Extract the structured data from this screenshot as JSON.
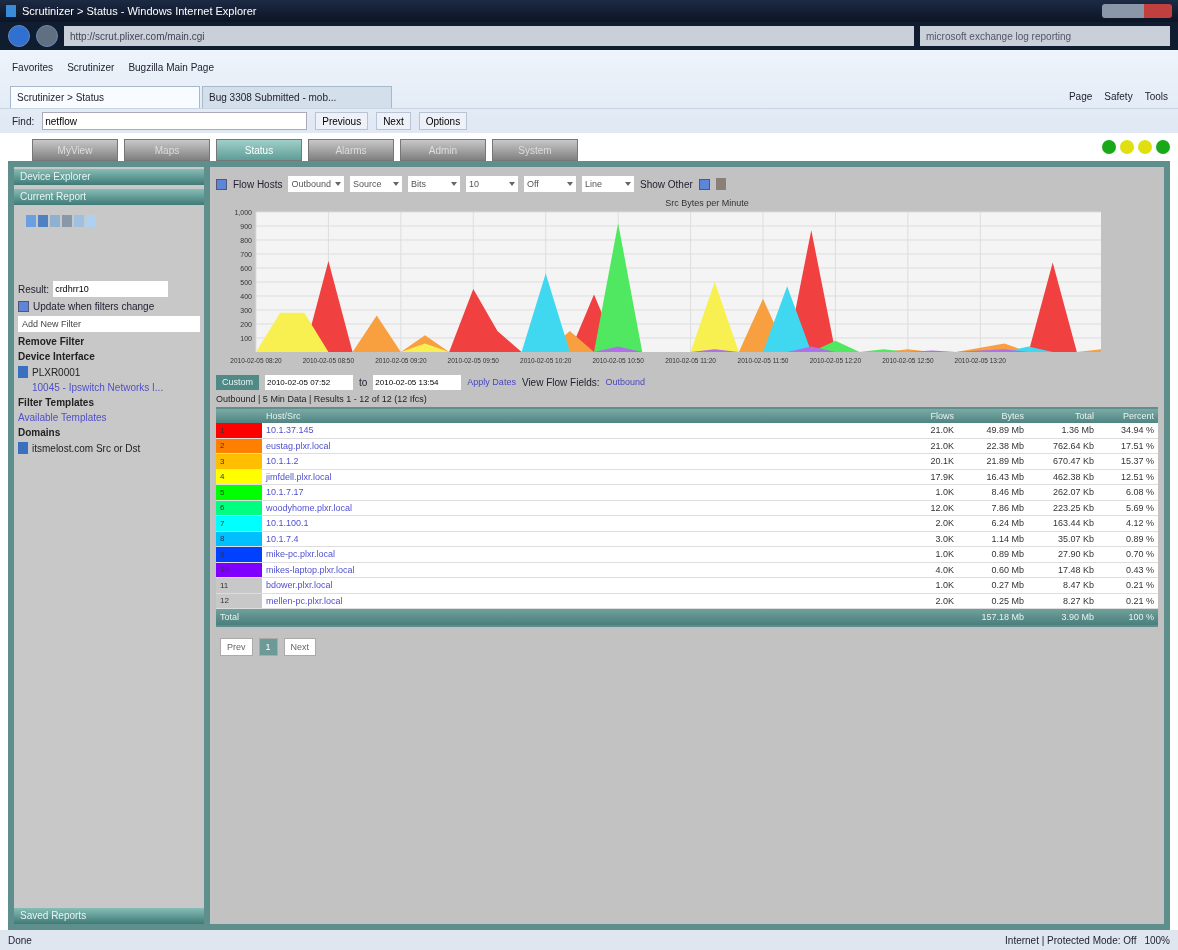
{
  "window": {
    "title": "Scrutinizer > Status - Windows Internet Explorer"
  },
  "address_bar": {
    "url": "http://scrut.plixer.com/main.cgi",
    "search_placeholder": "microsoft exchange log reporting"
  },
  "favorites_bar": {
    "items": [
      "Favorites",
      "Scrutinizer",
      "Bugzilla Main Page"
    ]
  },
  "browser_tabs": [
    {
      "label": "Scrutinizer > Status",
      "selected": true
    },
    {
      "label": "Bug 3308 Submitted - mob...",
      "selected": false
    }
  ],
  "command_bar": [
    "Page",
    "Safety",
    "Tools"
  ],
  "find_bar": {
    "label": "Find:",
    "value": "netflow",
    "buttons": [
      "Previous",
      "Next",
      "Options"
    ]
  },
  "app_tabs": [
    {
      "label": "MyView",
      "selected": false
    },
    {
      "label": "Maps",
      "selected": false
    },
    {
      "label": "Status",
      "selected": true
    },
    {
      "label": "Alarms",
      "selected": false
    },
    {
      "label": "Admin",
      "selected": false
    },
    {
      "label": "System",
      "selected": false
    }
  ],
  "status_lights": [
    {
      "color": "#18a818"
    },
    {
      "color": "#e0e010"
    },
    {
      "color": "#e0e010"
    },
    {
      "color": "#18a818"
    }
  ],
  "sidebar": {
    "headers": [
      "Device Explorer",
      "Current Report"
    ],
    "result_label": "Result:",
    "result_value": "crdhrr10",
    "update_label": "Update when filters change",
    "update_checked": true,
    "add_filter": "Add New Filter",
    "sections": [
      {
        "title": "Remove Filter"
      },
      {
        "title": "Device Interface",
        "items": [
          {
            "text": "PLXR0001",
            "kind": "device"
          },
          {
            "text": "10045 - Ipswitch Networks I...",
            "kind": "link"
          }
        ]
      },
      {
        "title": "Filter Templates",
        "items": [
          {
            "text": "Available Templates",
            "kind": "link"
          }
        ]
      },
      {
        "title": "Domains",
        "items": [
          {
            "text": "itsmelost.com Src or Dst",
            "kind": "device"
          }
        ]
      }
    ],
    "footer": "Saved Reports"
  },
  "report_toolbar": {
    "flow_hosts_label": "Flow Hosts",
    "flow_hosts_checked": true,
    "selects": [
      "Outbound",
      "Source",
      "Bits",
      "10",
      "Off",
      "Line"
    ],
    "show_other_label": "Show Other",
    "show_other_checked": true
  },
  "chart": {
    "chart_data": {
      "type": "area",
      "stacked": false,
      "grid": true,
      "title": "Src Bytes per Minute",
      "categories": [
        "2010-02-05 08:20",
        null,
        null,
        "2010-02-05 08:50",
        null,
        null,
        "2010-02-05 09:20",
        null,
        null,
        "2010-02-05 09:50",
        null,
        null,
        "2010-02-05 10:20",
        null,
        null,
        "2010-02-05 10:50",
        null,
        null,
        "2010-02-05 11:20",
        null,
        null,
        "2010-02-05 11:50",
        null,
        null,
        "2010-02-05 12:20",
        null,
        null,
        "2010-02-05 12:50",
        null,
        null,
        "2010-02-05 13:20",
        null,
        null,
        null,
        null,
        null
      ],
      "ylim": [
        0,
        1000
      ],
      "yticks": [
        {
          "value": 100,
          "label": "100"
        },
        {
          "value": 200,
          "label": "200"
        },
        {
          "value": 300,
          "label": "300"
        },
        {
          "value": 400,
          "label": "400"
        },
        {
          "value": 500,
          "label": "500"
        },
        {
          "value": 600,
          "label": "600"
        },
        {
          "value": 700,
          "label": "700"
        },
        {
          "value": 800,
          "label": "800"
        },
        {
          "value": 900,
          "label": "900"
        },
        {
          "value": 1000,
          "label": "1,000"
        }
      ],
      "series": [
        {
          "color": "#f04040",
          "values": [
            0,
            0,
            0,
            650,
            0,
            0,
            0,
            0,
            0,
            450,
            150,
            0,
            0,
            0,
            410,
            0,
            0,
            0,
            0,
            0,
            0,
            0,
            0,
            870,
            0,
            0,
            0,
            0,
            0,
            0,
            0,
            0,
            0,
            640,
            0,
            0
          ]
        },
        {
          "color": "#f8a040",
          "values": [
            0,
            0,
            0,
            0,
            0,
            260,
            0,
            120,
            0,
            0,
            0,
            0,
            0,
            150,
            0,
            0,
            0,
            0,
            0,
            0,
            0,
            380,
            0,
            0,
            0,
            0,
            0,
            20,
            0,
            0,
            30,
            60,
            0,
            0,
            0,
            20
          ]
        },
        {
          "color": "#f8f050",
          "values": [
            0,
            280,
            280,
            0,
            0,
            0,
            0,
            60,
            0,
            0,
            0,
            0,
            0,
            0,
            0,
            0,
            0,
            0,
            0,
            500,
            0,
            0,
            0,
            0,
            0,
            0,
            0,
            0,
            0,
            0,
            0,
            0,
            0,
            0,
            0,
            0
          ]
        },
        {
          "color": "#50e860",
          "values": [
            0,
            0,
            0,
            0,
            0,
            0,
            0,
            0,
            0,
            0,
            0,
            0,
            0,
            0,
            0,
            920,
            0,
            0,
            0,
            0,
            0,
            0,
            0,
            0,
            80,
            0,
            20,
            0,
            0,
            0,
            0,
            0,
            0,
            0,
            0,
            0
          ]
        },
        {
          "color": "#40d8f0",
          "values": [
            0,
            0,
            0,
            0,
            0,
            0,
            0,
            0,
            0,
            0,
            0,
            0,
            560,
            0,
            0,
            0,
            0,
            0,
            0,
            0,
            0,
            0,
            470,
            0,
            0,
            0,
            0,
            0,
            0,
            0,
            0,
            0,
            40,
            0,
            0,
            0
          ]
        },
        {
          "color": "#b070e8",
          "values": [
            0,
            0,
            0,
            0,
            0,
            0,
            0,
            0,
            0,
            0,
            0,
            0,
            0,
            0,
            0,
            40,
            0,
            0,
            0,
            20,
            0,
            0,
            0,
            40,
            0,
            0,
            0,
            0,
            10,
            0,
            10,
            20,
            0,
            0,
            0,
            0
          ]
        }
      ]
    }
  },
  "date_range": {
    "custom": "Custom",
    "from": "2010-02-05 07:52",
    "to_label": "to",
    "to": "2010-02-05 13:54",
    "apply": "Apply Dates",
    "view_label": "View Flow Fields:",
    "view_value": "Outbound"
  },
  "summary": "Outbound | 5 Min Data | Results 1 - 12 of 12 (12 Ifcs)",
  "table": {
    "columns": [
      "Host/Src",
      "Flows",
      "Bytes",
      "Total",
      "Percent"
    ],
    "rows": [
      {
        "rank": "1",
        "color": "#ff0000",
        "host": "10.1.37.145",
        "flows": "21.0K",
        "bytes": "49.89 Mb",
        "total": "1.36 Mb",
        "percent": "34.94 %"
      },
      {
        "rank": "2",
        "color": "#ff8000",
        "host": "eustag.plxr.local",
        "flows": "21.0K",
        "bytes": "22.38 Mb",
        "total": "762.64 Kb",
        "percent": "17.51 %"
      },
      {
        "rank": "3",
        "color": "#ffbf00",
        "host": "10.1.1.2",
        "flows": "20.1K",
        "bytes": "21.89 Mb",
        "total": "670.47 Kb",
        "percent": "15.37 %"
      },
      {
        "rank": "4",
        "color": "#ffff00",
        "host": "jimfdell.plxr.local",
        "flows": "17.9K",
        "bytes": "16.43 Mb",
        "total": "462.38 Kb",
        "percent": "12.51 %"
      },
      {
        "rank": "5",
        "color": "#00ff00",
        "host": "10.1.7.17",
        "flows": "1.0K",
        "bytes": "8.46 Mb",
        "total": "262.07 Kb",
        "percent": "6.08 %"
      },
      {
        "rank": "6",
        "color": "#00ff80",
        "host": "woodyhome.plxr.local",
        "flows": "12.0K",
        "bytes": "7.86 Mb",
        "total": "223.25 Kb",
        "percent": "5.69 %"
      },
      {
        "rank": "7",
        "color": "#00ffff",
        "host": "10.1.100.1",
        "flows": "2.0K",
        "bytes": "6.24 Mb",
        "total": "163.44 Kb",
        "percent": "4.12 %"
      },
      {
        "rank": "8",
        "color": "#00bfff",
        "host": "10.1.7.4",
        "flows": "3.0K",
        "bytes": "1.14 Mb",
        "total": "35.07 Kb",
        "percent": "0.89 %"
      },
      {
        "rank": "9",
        "color": "#0040ff",
        "host": "mike-pc.plxr.local",
        "flows": "1.0K",
        "bytes": "0.89 Mb",
        "total": "27.90 Kb",
        "percent": "0.70 %"
      },
      {
        "rank": "10",
        "color": "#8000ff",
        "host": "mikes-laptop.plxr.local",
        "flows": "4.0K",
        "bytes": "0.60 Mb",
        "total": "17.48 Kb",
        "percent": "0.43 %"
      },
      {
        "rank": "11",
        "color": "#c8c8c8",
        "host": "bdower.plxr.local",
        "flows": "1.0K",
        "bytes": "0.27 Mb",
        "total": "8.47 Kb",
        "percent": "0.21 %"
      },
      {
        "rank": "12",
        "color": "#c8c8c8",
        "host": "mellen-pc.plxr.local",
        "flows": "2.0K",
        "bytes": "0.25 Mb",
        "total": "8.27 Kb",
        "percent": "0.21 %"
      }
    ],
    "footer": {
      "label": "Total",
      "bytes": "157.18 Mb",
      "total": "3.90 Mb",
      "percent": "100 %"
    }
  },
  "pagination": [
    {
      "label": "Prev",
      "selected": false
    },
    {
      "label": "1",
      "selected": true
    },
    {
      "label": "Next",
      "selected": false
    }
  ],
  "status_bar": {
    "text": "Done",
    "zone": "Internet | Protected Mode: Off",
    "zoom": "100%"
  }
}
